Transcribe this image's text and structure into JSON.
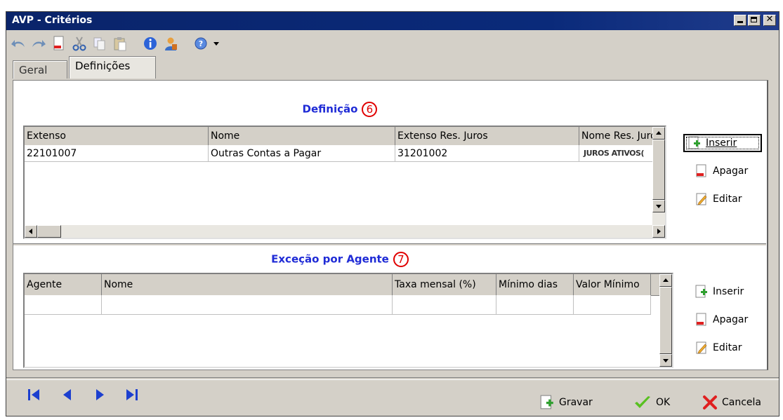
{
  "window": {
    "title": "AVP - Critérios"
  },
  "toolbar": {
    "icons": [
      "undo-icon",
      "redo-icon",
      "new-document-icon",
      "cut-icon",
      "copy-icon",
      "paste-icon",
      "info-icon",
      "user-icon",
      "help-icon",
      "dropdown-arrow-icon"
    ]
  },
  "tabs": [
    {
      "label": "Geral"
    },
    {
      "label": "Definições",
      "selected": true
    }
  ],
  "definicao": {
    "title": "Definição",
    "badge": "6",
    "columns": [
      "Extenso",
      "Nome",
      "Extenso Res. Juros",
      "Nome Res. Juro"
    ],
    "rows": [
      [
        "22101007",
        "Outras Contas a Pagar",
        "31201002",
        "JUROS ATIVOS("
      ]
    ],
    "buttons": {
      "insert": "Inserir",
      "delete": "Apagar",
      "edit": "Editar"
    }
  },
  "excecao": {
    "title": "Exceção por Agente",
    "badge": "7",
    "columns": [
      "Agente",
      "Nome",
      "Taxa mensal (%)",
      "Mínimo dias",
      "Valor Mínimo"
    ],
    "rows": [
      [
        "",
        "",
        "",
        "",
        ""
      ]
    ],
    "buttons": {
      "insert": "Inserir",
      "delete": "Apagar",
      "edit": "Editar"
    }
  },
  "footer": {
    "nav_icons": [
      "first-record-icon",
      "previous-record-icon",
      "next-record-icon",
      "last-record-icon"
    ],
    "save": "Gravar",
    "ok": "OK",
    "cancel": "Cancela"
  },
  "colors": {
    "title_bar": "#0a246a",
    "section_title": "#1f2bd6",
    "badge": "#e00000",
    "nav_arrows": "#1c3fcf"
  }
}
